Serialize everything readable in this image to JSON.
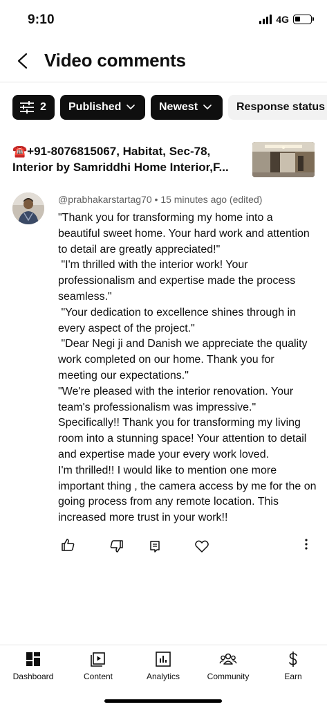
{
  "status_bar": {
    "time": "9:10",
    "network": "4G"
  },
  "header": {
    "title": "Video comments"
  },
  "filters": {
    "filter_count": "2",
    "published": "Published",
    "sort": "Newest",
    "response_status": "Response status"
  },
  "video": {
    "title": "☎️+91-8076815067, Habitat, Sec-78, Interior by Samriddhi Home Interior,F..."
  },
  "comment": {
    "author": "@prabhakarstartag70",
    "separator": "•",
    "timestamp": "15 minutes ago (edited)",
    "text": "\"Thank you for transforming my home into a beautiful sweet home. Your hard work and attention to detail are greatly appreciated!\"\n \"I'm thrilled with the interior work! Your professionalism and expertise made the process seamless.\"\n \"Your dedication to excellence shines through in every aspect of the project.\"\n \"Dear Negi ji and Danish we appreciate the quality work completed on our home. Thank you for meeting our expectations.\"\n\"We're pleased with the interior renovation. Your team's professionalism was impressive.\"\nSpecifically!! Thank you for transforming my living room into a stunning space! Your attention to detail and expertise made your every work loved.\nI'm thrilled!! I would like to mention one more important thing , the camera access by me for the on going process from any remote location. This increased more trust in your work!!"
  },
  "comment_actions": [
    "thumb-up-icon",
    "thumb-down-icon",
    "reply-icon",
    "heart-icon",
    "more-icon"
  ],
  "bottom_nav": {
    "dashboard": "Dashboard",
    "content": "Content",
    "analytics": "Analytics",
    "community": "Community",
    "earn": "Earn"
  },
  "colors": {
    "text": "#0f0f0f",
    "secondary": "#606060",
    "chip_dark": "#0f0f0f",
    "chip_light": "#f2f2f2"
  }
}
